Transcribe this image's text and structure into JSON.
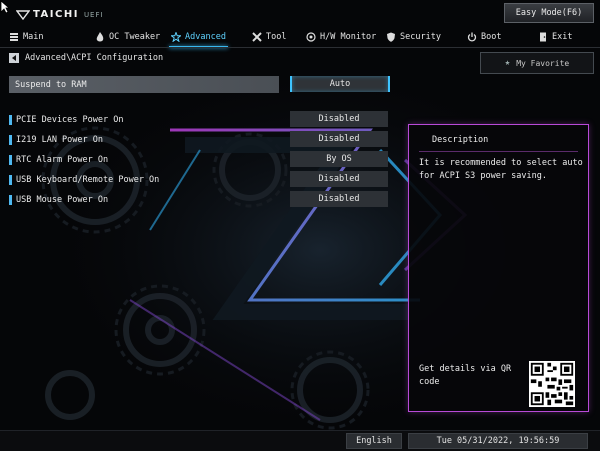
{
  "header": {
    "logo_text": "TAICHI",
    "logo_sub": "UEFI",
    "easy_mode_label": "Easy Mode(F6)"
  },
  "nav": {
    "items": [
      {
        "label": "Main",
        "icon": "main-menu-icon"
      },
      {
        "label": "OC Tweaker",
        "icon": "flame-icon"
      },
      {
        "label": "Advanced",
        "icon": "star-icon",
        "active": true
      },
      {
        "label": "Tool",
        "icon": "tools-icon"
      },
      {
        "label": "H/W Monitor",
        "icon": "globe-icon"
      },
      {
        "label": "Security",
        "icon": "shield-icon"
      },
      {
        "label": "Boot",
        "icon": "power-icon"
      },
      {
        "label": "Exit",
        "icon": "exit-door-icon"
      }
    ]
  },
  "breadcrumb": "Advanced\\ACPI Configuration",
  "favorite_label": "My Favorite",
  "settings": [
    {
      "label": "Suspend to RAM",
      "value": "Auto",
      "selected": true
    },
    {
      "label": "PCIE Devices Power On",
      "value": "Disabled"
    },
    {
      "label": "I219 LAN Power On",
      "value": "Disabled"
    },
    {
      "label": "RTC Alarm Power On",
      "value": "By OS"
    },
    {
      "label": "USB Keyboard/Remote Power On",
      "value": "Disabled"
    },
    {
      "label": "USB Mouse Power On",
      "value": "Disabled"
    }
  ],
  "description": {
    "title": "Description",
    "text": "It is recommended to select auto for ACPI S3 power saving.",
    "qr_text": "Get details via QR code"
  },
  "footer": {
    "language": "English",
    "datetime": "Tue 05/31/2022, 19:56:59"
  },
  "colors": {
    "accent": "#38b8f0",
    "panel_border": "#b84ad8",
    "highlight_row": "#565b62"
  }
}
